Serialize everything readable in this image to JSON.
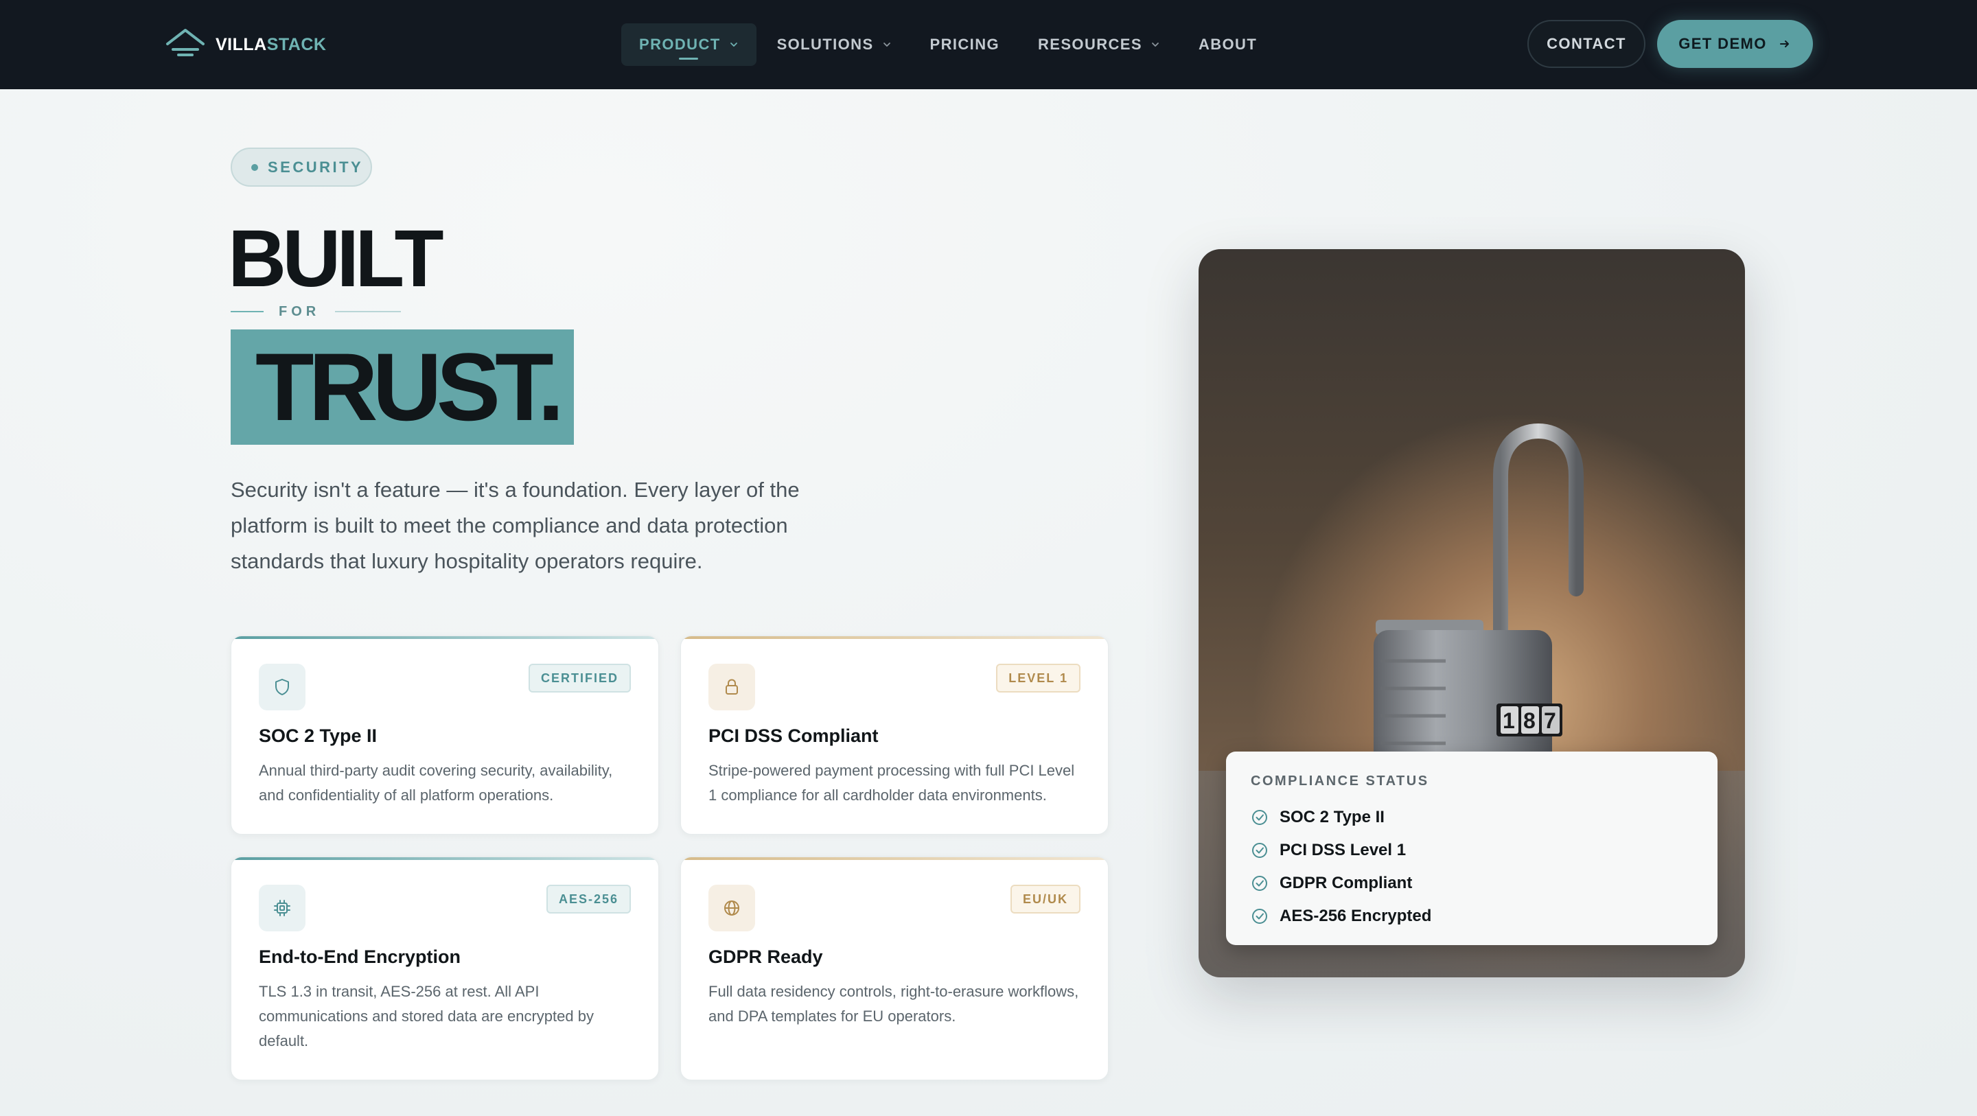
{
  "brand": {
    "name_part1": "VILLA",
    "name_part2": "STACK"
  },
  "nav": {
    "items": [
      {
        "label": "PRODUCT",
        "has_dropdown": true,
        "active": true
      },
      {
        "label": "SOLUTIONS",
        "has_dropdown": true,
        "active": false
      },
      {
        "label": "PRICING",
        "has_dropdown": false,
        "active": false
      },
      {
        "label": "RESOURCES",
        "has_dropdown": true,
        "active": false
      },
      {
        "label": "ABOUT",
        "has_dropdown": false,
        "active": false
      }
    ],
    "contact_label": "CONTACT",
    "demo_label": "GET DEMO"
  },
  "hero": {
    "eyebrow": "SECURITY",
    "headline_line1": "BUILT",
    "headline_connector": "FOR",
    "headline_line2": "TRUST.",
    "lead": "Security isn't a feature — it's a foundation. Every layer of the platform is built to meet the compliance and data protection standards that luxury hospitality operators require."
  },
  "cards": [
    {
      "icon": "shield-icon",
      "badge": "CERTIFIED",
      "title": "SOC 2 Type II",
      "description": "Annual third-party audit covering security, availability, and confidentiality of all platform operations."
    },
    {
      "icon": "lock-icon",
      "badge": "LEVEL 1",
      "title": "PCI DSS Compliant",
      "description": "Stripe-powered payment processing with full PCI Level 1 compliance for all cardholder data environments."
    },
    {
      "icon": "chip-icon",
      "badge": "AES-256",
      "title": "End-to-End Encryption",
      "description": "TLS 1.3 in transit, AES-256 at rest. All API communications and stored data are encrypted by default."
    },
    {
      "icon": "globe-icon",
      "badge": "EU/UK",
      "title": "GDPR Ready",
      "description": "Full data residency controls, right-to-erasure workflows, and DPA templates for EU operators."
    }
  ],
  "compliance": {
    "title": "COMPLIANCE STATUS",
    "items": [
      "SOC 2 Type II",
      "PCI DSS Level 1",
      "GDPR Compliant",
      "AES-256 Encrypted"
    ]
  },
  "colors": {
    "nav_bg": "#121820",
    "accent_teal": "#5b9fa2",
    "accent_gold": "#b08a4c",
    "page_bg": "#eef2f3",
    "text_dark": "#111619"
  }
}
